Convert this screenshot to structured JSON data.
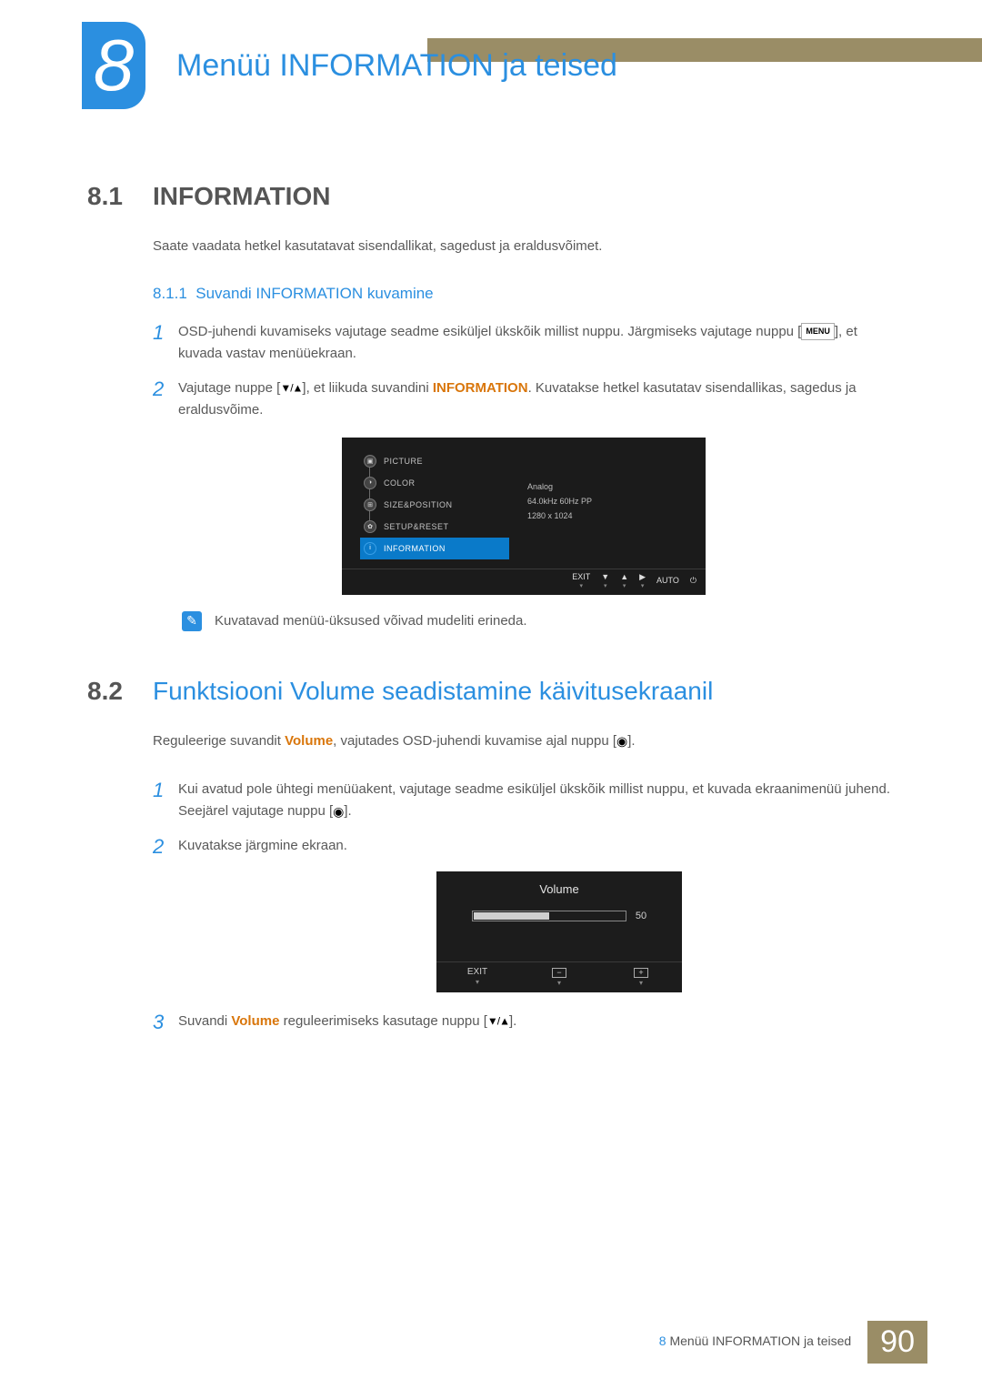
{
  "chapter": {
    "number": "8",
    "title": "Menüü INFORMATION ja teised"
  },
  "section81": {
    "num": "8.1",
    "title": "INFORMATION",
    "intro": "Saate vaadata hetkel kasutatavat sisendallikat, sagedust ja eraldusvõimet.",
    "sub": {
      "num": "8.1.1",
      "title": "Suvandi INFORMATION kuvamine"
    },
    "step1_a": "OSD-juhendi kuvamiseks vajutage seadme esiküljel ükskõik millist nuppu. Järgmiseks vajutage nuppu [",
    "step1_menu": "MENU",
    "step1_b": "], et kuvada vastav menüüekraan.",
    "step2_a": "Vajutage nuppe [",
    "step2_b": "], et liikuda suvandini ",
    "step2_hl": "INFORMATION",
    "step2_c": ". Kuvatakse hetkel kasutatav sisendallikas, sagedus ja eraldusvõime.",
    "note": "Kuvatavad menüü-üksused võivad mudeliti erineda."
  },
  "osd1": {
    "menu": [
      "PICTURE",
      "COLOR",
      "SIZE&POSITION",
      "SETUP&RESET",
      "INFORMATION"
    ],
    "info": [
      "Analog",
      "64.0kHz 60Hz PP",
      "1280 x 1024"
    ],
    "footer": {
      "exit": "EXIT",
      "auto": "AUTO"
    }
  },
  "section82": {
    "num": "8.2",
    "title": "Funktsiooni Volume seadistamine käivitusekraanil",
    "intro_a": "Reguleerige suvandit ",
    "intro_hl": "Volume",
    "intro_b": ", vajutades OSD-juhendi kuvamise ajal nuppu [",
    "intro_c": "].",
    "step1_a": "Kui avatud pole ühtegi menüüakent, vajutage seadme esiküljel ükskõik millist nuppu, et kuvada ekraanimenüü juhend. Seejärel vajutage nuppu [",
    "step1_b": "].",
    "step2": "Kuvatakse järgmine ekraan.",
    "step3_a": "Suvandi ",
    "step3_hl": "Volume",
    "step3_b": " reguleerimiseks kasutage nuppu [",
    "step3_c": "]."
  },
  "osd2": {
    "title": "Volume",
    "value": "50",
    "exit": "EXIT",
    "minus": "−",
    "plus": "+"
  },
  "footer": {
    "label": "Menüü INFORMATION ja teised",
    "chapnum": "8",
    "page": "90"
  }
}
